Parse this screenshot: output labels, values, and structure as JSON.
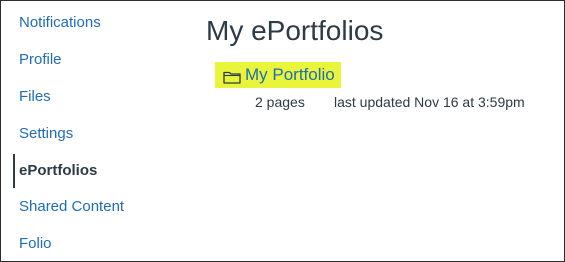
{
  "sidebar": {
    "items": [
      {
        "label": "Notifications"
      },
      {
        "label": "Profile"
      },
      {
        "label": "Files"
      },
      {
        "label": "Settings"
      },
      {
        "label": "ePortfolios"
      },
      {
        "label": "Shared Content"
      },
      {
        "label": "Folio"
      }
    ],
    "active_item": "ePortfolios"
  },
  "main": {
    "title": "My ePortfolios",
    "portfolio": {
      "name": "My Portfolio",
      "icon": "folder-icon",
      "pages": "2 pages",
      "last_updated": "last updated Nov 16 at 3:59pm"
    }
  },
  "colors": {
    "link": "#1f6db5",
    "text": "#2d3b45",
    "highlight": "#e8f53a",
    "border": "#2d2d2d"
  }
}
